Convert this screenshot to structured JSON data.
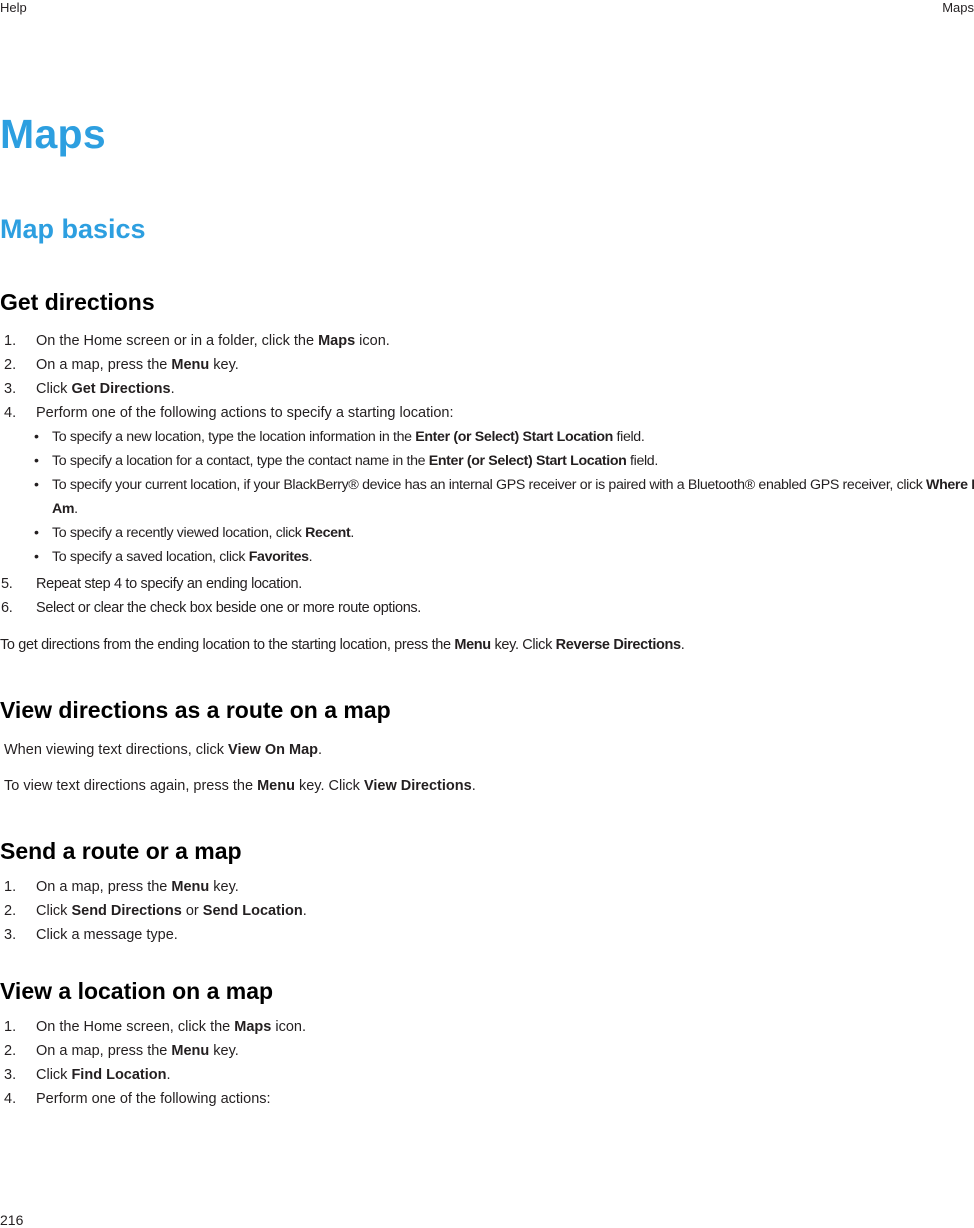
{
  "header": {
    "left": "Help",
    "right": "Maps"
  },
  "page_number": "216",
  "chapter_title": "Maps",
  "section_title": "Map basics",
  "topics": {
    "get_directions": {
      "title": "Get directions",
      "steps": [
        {
          "num": "1.",
          "pre": "On the Home screen or in a folder, click the ",
          "bold": "Maps",
          "post": " icon."
        },
        {
          "num": "2.",
          "pre": "On a map, press the ",
          "bold": "Menu",
          "post": " key."
        },
        {
          "num": "3.",
          "pre": "Click ",
          "bold": "Get Directions",
          "post": "."
        },
        {
          "num": "4.",
          "text": "Perform one of the following actions to specify a starting location:"
        }
      ],
      "bullets": [
        {
          "pre": "To specify a new location, type the location information in the ",
          "bold": "Enter (or Select) Start Location",
          "post": " field."
        },
        {
          "pre": "To specify a location for a contact, type the contact name in the ",
          "bold": "Enter (or Select) Start Location",
          "post": " field."
        },
        {
          "pre": "To specify your current location, if your BlackBerry® device has an internal GPS receiver or is paired with a Bluetooth® enabled GPS receiver, click ",
          "bold": "Where I Am",
          "post": "."
        },
        {
          "pre": "To specify a recently viewed location, click ",
          "bold": "Recent",
          "post": "."
        },
        {
          "pre": "To specify a saved location, click ",
          "bold": "Favorites",
          "post": "."
        }
      ],
      "steps_after": [
        {
          "num": "5.",
          "text": "Repeat step 4 to specify an ending location."
        },
        {
          "num": "6.",
          "text": "Select or clear the check box beside one or more route options."
        }
      ],
      "note": {
        "pre": "To get directions from the ending location to the starting location, press the ",
        "bold1": "Menu",
        "mid": " key. Click ",
        "bold2": "Reverse Directions",
        "post": "."
      }
    },
    "view_route": {
      "title": "View directions as a route on a map",
      "para1": {
        "pre": "When viewing text directions, click ",
        "bold": "View On Map",
        "post": "."
      },
      "para2": {
        "pre": "To view text directions again, press the ",
        "bold1": "Menu",
        "mid": " key. Click ",
        "bold2": "View Directions",
        "post": "."
      }
    },
    "send_route": {
      "title": "Send a route or a map",
      "steps": [
        {
          "num": "1.",
          "pre": "On a map, press the ",
          "bold": "Menu",
          "post": " key."
        },
        {
          "num": "2.",
          "pre": "Click ",
          "bold": "Send Directions",
          "mid": " or ",
          "bold2": "Send Location",
          "post": "."
        },
        {
          "num": "3.",
          "text": "Click a message type."
        }
      ]
    },
    "view_location": {
      "title": "View a location on a map",
      "steps": [
        {
          "num": "1.",
          "pre": "On the Home screen, click the ",
          "bold": "Maps",
          "post": " icon."
        },
        {
          "num": "2.",
          "pre": "On a map, press the ",
          "bold": "Menu",
          "post": " key."
        },
        {
          "num": "3.",
          "pre": "Click ",
          "bold": "Find Location",
          "post": "."
        },
        {
          "num": "4.",
          "text": "Perform one of the following actions:"
        }
      ]
    }
  },
  "colors": {
    "heading_blue": "#2d9fe0",
    "text": "#231f20"
  }
}
